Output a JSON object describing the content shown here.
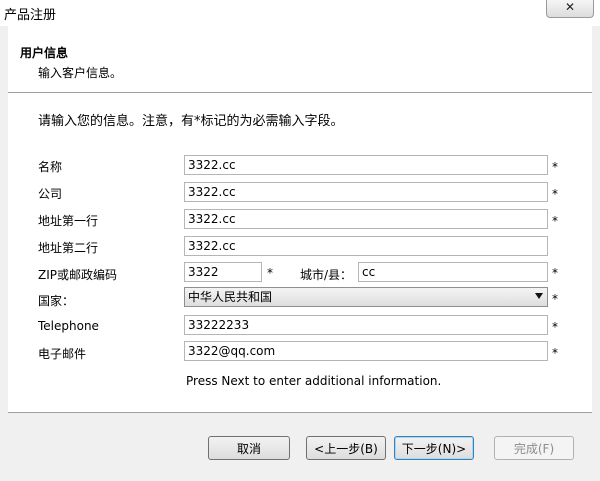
{
  "window": {
    "title": "产品注册",
    "close_glyph": "✕"
  },
  "header": {
    "title": "用户信息",
    "subtitle": "输入客户信息。"
  },
  "intro": "请输入您的信息。注意，有*标记的为必需输入字段。",
  "required_mark": "*",
  "form": {
    "name": {
      "label": "名称",
      "value": "3322.cc"
    },
    "company": {
      "label": "公司",
      "value": "3322.cc"
    },
    "address1": {
      "label": "地址第一行",
      "value": "3322.cc"
    },
    "address2": {
      "label": "地址第二行",
      "value": "3322.cc"
    },
    "zip": {
      "label": "ZIP或邮政编码",
      "value": "3322"
    },
    "city": {
      "label": "城市/县：",
      "value": "cc"
    },
    "country": {
      "label": "国家：",
      "value": "中华人民共和国"
    },
    "telephone": {
      "label": "Telephone",
      "value": "33222233"
    },
    "email": {
      "label": "电子邮件",
      "value": "3322@qq.com"
    }
  },
  "hint": "Press Next to enter additional information.",
  "buttons": {
    "cancel": "取消",
    "back": "<上一步(B)",
    "next": "下一步(N)>",
    "finish": "完成(F)"
  }
}
